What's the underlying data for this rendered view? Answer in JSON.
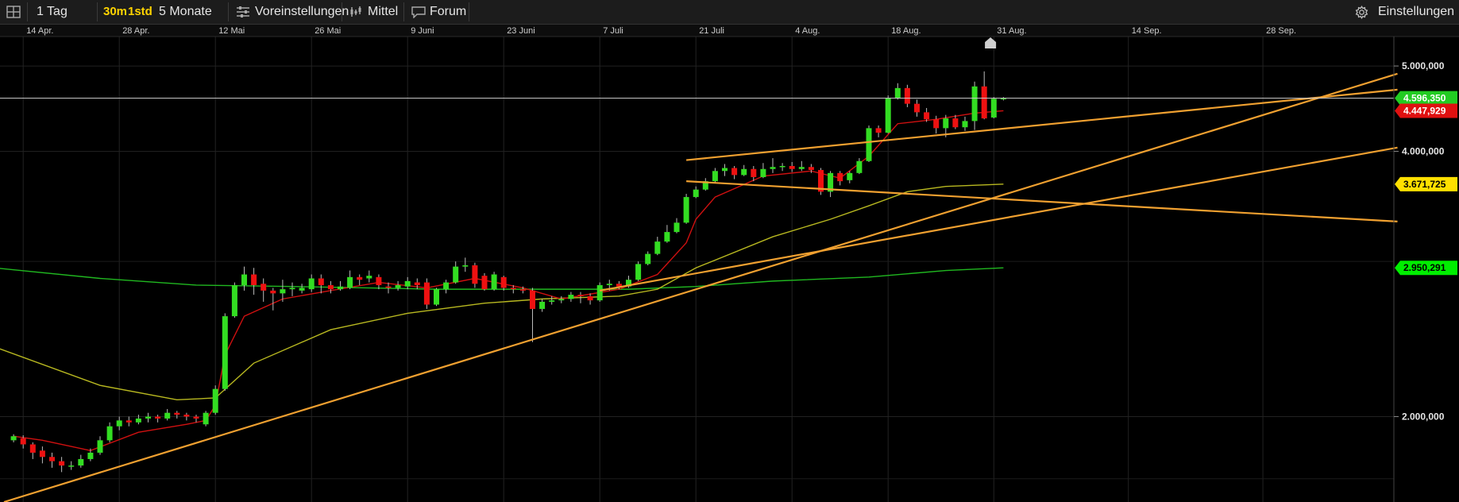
{
  "toolbar": {
    "period": "1 Tag",
    "interval_30m": "30m",
    "interval_1std": "1std",
    "range": "5 Monate",
    "presets": "Voreinstellungen",
    "average": "Mittel",
    "forum": "Forum",
    "settings": "Einstellungen"
  },
  "icons": [
    "layout-icon",
    "sliders-icon",
    "chart-icon",
    "chat-icon",
    "gear-icon"
  ],
  "colors": {
    "up": "#33dd22",
    "down": "#ee1111",
    "trendline": "#f0a030",
    "ma_short": "#d01010",
    "ma_mid": "#b8b820",
    "ma_long": "#20b820",
    "last_price": "#22cc22",
    "badge_red": "#e01010",
    "badge_yellow": "#ffe000",
    "badge_green": "#00ee00"
  },
  "chart_data": {
    "type": "candlestick",
    "scale": "log",
    "grid": true,
    "x_ticks": [
      "14 Apr.",
      "28 Apr.",
      "12 Mai",
      "26 Mai",
      "9 Juni",
      "23 Juni",
      "7 Juli",
      "21 Juli",
      "4 Aug.",
      "18 Aug.",
      "31 Aug.",
      "14 Sep.",
      "28 Sep."
    ],
    "y_ticks": [
      {
        "value": 2000000,
        "label": "2.000,000"
      },
      {
        "value": 4000000,
        "label": "4.000,000"
      },
      {
        "value": 5000000,
        "label": "5.000,000"
      }
    ],
    "y_range": [
      1600000,
      5400000
    ],
    "badges": [
      {
        "value": 4596350,
        "label": "4.596,350",
        "kind": "last_price"
      },
      {
        "value": 4447929,
        "label": "4.447,929",
        "kind": "badge_red"
      },
      {
        "value": 3671725,
        "label": "3.671,725",
        "kind": "badge_yellow"
      },
      {
        "value": 2950291,
        "label": "2.950,291",
        "kind": "badge_green"
      }
    ],
    "candles": [
      [
        1,
        1880000,
        1900000,
        1870000,
        1910000
      ],
      [
        2,
        1890000,
        1860000,
        1840000,
        1905000
      ],
      [
        3,
        1860000,
        1820000,
        1790000,
        1870000
      ],
      [
        4,
        1830000,
        1800000,
        1770000,
        1850000
      ],
      [
        5,
        1800000,
        1780000,
        1750000,
        1820000
      ],
      [
        6,
        1780000,
        1760000,
        1730000,
        1800000
      ],
      [
        7,
        1760000,
        1760000,
        1740000,
        1780000
      ],
      [
        8,
        1760000,
        1790000,
        1750000,
        1810000
      ],
      [
        9,
        1790000,
        1820000,
        1780000,
        1840000
      ],
      [
        10,
        1820000,
        1880000,
        1810000,
        1900000
      ],
      [
        11,
        1880000,
        1950000,
        1870000,
        1970000
      ],
      [
        12,
        1950000,
        1980000,
        1930000,
        2000000
      ],
      [
        13,
        1980000,
        1970000,
        1950000,
        2000000
      ],
      [
        14,
        1970000,
        1990000,
        1960000,
        2010000
      ],
      [
        15,
        1990000,
        2000000,
        1970000,
        2020000
      ],
      [
        16,
        2000000,
        1990000,
        1970000,
        2010000
      ],
      [
        17,
        1990000,
        2020000,
        1980000,
        2040000
      ],
      [
        18,
        2020000,
        2010000,
        1990000,
        2030000
      ],
      [
        19,
        2010000,
        2000000,
        1980000,
        2020000
      ],
      [
        20,
        2000000,
        1990000,
        1970000,
        2010000
      ],
      [
        21,
        1960000,
        2020000,
        1950000,
        2030000
      ],
      [
        22,
        2020000,
        2150000,
        2010000,
        2170000
      ],
      [
        23,
        2150000,
        2600000,
        2140000,
        2620000
      ],
      [
        24,
        2600000,
        2820000,
        2590000,
        2840000
      ],
      [
        25,
        2820000,
        2900000,
        2780000,
        2960000
      ],
      [
        26,
        2900000,
        2820000,
        2750000,
        2950000
      ],
      [
        27,
        2830000,
        2780000,
        2700000,
        2870000
      ],
      [
        28,
        2780000,
        2760000,
        2640000,
        2800000
      ],
      [
        29,
        2760000,
        2790000,
        2700000,
        2860000
      ],
      [
        30,
        2790000,
        2800000,
        2740000,
        2840000
      ],
      [
        31,
        2780000,
        2800000,
        2760000,
        2830000
      ],
      [
        32,
        2790000,
        2870000,
        2770000,
        2900000
      ],
      [
        33,
        2870000,
        2820000,
        2760000,
        2900000
      ],
      [
        34,
        2820000,
        2790000,
        2760000,
        2850000
      ],
      [
        35,
        2790000,
        2810000,
        2780000,
        2850000
      ],
      [
        36,
        2800000,
        2880000,
        2790000,
        2930000
      ],
      [
        37,
        2880000,
        2860000,
        2820000,
        2900000
      ],
      [
        38,
        2870000,
        2890000,
        2840000,
        2930000
      ],
      [
        39,
        2880000,
        2820000,
        2790000,
        2900000
      ],
      [
        40,
        2810000,
        2800000,
        2760000,
        2840000
      ],
      [
        41,
        2800000,
        2820000,
        2780000,
        2850000
      ],
      [
        42,
        2810000,
        2850000,
        2790000,
        2880000
      ],
      [
        43,
        2840000,
        2820000,
        2790000,
        2870000
      ],
      [
        44,
        2840000,
        2680000,
        2650000,
        2870000
      ],
      [
        45,
        2680000,
        2790000,
        2670000,
        2800000
      ],
      [
        46,
        2790000,
        2840000,
        2760000,
        2860000
      ],
      [
        47,
        2840000,
        2960000,
        2830000,
        3000000
      ],
      [
        48,
        2960000,
        2970000,
        2920000,
        3030000
      ],
      [
        49,
        2970000,
        2830000,
        2800000,
        2990000
      ],
      [
        50,
        2890000,
        2790000,
        2780000,
        2910000
      ],
      [
        51,
        2790000,
        2900000,
        2780000,
        2920000
      ],
      [
        52,
        2880000,
        2800000,
        2780000,
        2890000
      ],
      [
        53,
        2800000,
        2790000,
        2760000,
        2820000
      ],
      [
        54,
        2790000,
        2780000,
        2760000,
        2810000
      ],
      [
        55,
        2780000,
        2650000,
        2430000,
        2800000
      ],
      [
        56,
        2650000,
        2700000,
        2630000,
        2720000
      ],
      [
        57,
        2700000,
        2710000,
        2680000,
        2740000
      ],
      [
        58,
        2710000,
        2720000,
        2690000,
        2740000
      ],
      [
        59,
        2720000,
        2750000,
        2700000,
        2770000
      ],
      [
        60,
        2750000,
        2740000,
        2690000,
        2770000
      ],
      [
        61,
        2740000,
        2710000,
        2680000,
        2760000
      ],
      [
        62,
        2710000,
        2820000,
        2700000,
        2840000
      ],
      [
        63,
        2820000,
        2830000,
        2780000,
        2860000
      ],
      [
        64,
        2830000,
        2810000,
        2790000,
        2850000
      ],
      [
        65,
        2810000,
        2860000,
        2800000,
        2890000
      ],
      [
        66,
        2860000,
        2980000,
        2850000,
        3000000
      ],
      [
        67,
        2980000,
        3060000,
        2970000,
        3080000
      ],
      [
        68,
        3060000,
        3160000,
        3050000,
        3200000
      ],
      [
        69,
        3160000,
        3240000,
        3150000,
        3300000
      ],
      [
        70,
        3240000,
        3320000,
        3230000,
        3360000
      ],
      [
        71,
        3320000,
        3550000,
        3310000,
        3580000
      ],
      [
        72,
        3550000,
        3620000,
        3540000,
        3650000
      ],
      [
        73,
        3620000,
        3700000,
        3610000,
        3730000
      ],
      [
        74,
        3700000,
        3800000,
        3690000,
        3830000
      ],
      [
        75,
        3800000,
        3830000,
        3750000,
        3870000
      ],
      [
        76,
        3830000,
        3760000,
        3720000,
        3850000
      ],
      [
        77,
        3760000,
        3820000,
        3750000,
        3860000
      ],
      [
        78,
        3820000,
        3740000,
        3700000,
        3850000
      ],
      [
        79,
        3740000,
        3820000,
        3730000,
        3880000
      ],
      [
        80,
        3820000,
        3840000,
        3780000,
        3930000
      ],
      [
        81,
        3840000,
        3850000,
        3800000,
        3880000
      ],
      [
        82,
        3850000,
        3820000,
        3790000,
        3890000
      ],
      [
        83,
        3820000,
        3840000,
        3800000,
        3900000
      ],
      [
        84,
        3840000,
        3810000,
        3780000,
        3870000
      ],
      [
        85,
        3810000,
        3600000,
        3570000,
        3830000
      ],
      [
        86,
        3600000,
        3780000,
        3550000,
        3800000
      ],
      [
        87,
        3780000,
        3700000,
        3660000,
        3800000
      ],
      [
        88,
        3710000,
        3780000,
        3680000,
        3800000
      ],
      [
        89,
        3780000,
        3900000,
        3770000,
        3930000
      ],
      [
        90,
        3900000,
        4250000,
        3890000,
        4280000
      ],
      [
        91,
        4250000,
        4200000,
        4150000,
        4280000
      ],
      [
        92,
        4200000,
        4600000,
        4190000,
        4630000
      ],
      [
        93,
        4600000,
        4720000,
        4580000,
        4780000
      ],
      [
        94,
        4720000,
        4530000,
        4490000,
        4760000
      ],
      [
        95,
        4530000,
        4430000,
        4380000,
        4580000
      ],
      [
        96,
        4430000,
        4350000,
        4320000,
        4480000
      ],
      [
        97,
        4350000,
        4250000,
        4190000,
        4390000
      ],
      [
        98,
        4250000,
        4360000,
        4150000,
        4400000
      ],
      [
        99,
        4360000,
        4260000,
        4240000,
        4400000
      ],
      [
        100,
        4260000,
        4330000,
        4220000,
        4380000
      ],
      [
        101,
        4330000,
        4740000,
        4230000,
        4800000
      ],
      [
        102,
        4740000,
        4360000,
        4350000,
        4930000
      ],
      [
        103,
        4370000,
        4590000,
        4360000,
        4610000
      ],
      [
        104,
        4590000,
        4596350,
        4570000,
        4610000
      ]
    ],
    "x_ticks_at": [
      2,
      12,
      22,
      32,
      42,
      52,
      62,
      72,
      82,
      92,
      103,
      117,
      131
    ],
    "ma_short": [
      [
        1,
        1900000
      ],
      [
        4,
        1880000
      ],
      [
        7,
        1850000
      ],
      [
        9,
        1830000
      ],
      [
        14,
        1920000
      ],
      [
        19,
        1960000
      ],
      [
        21,
        1980000
      ],
      [
        22,
        2060000
      ],
      [
        23,
        2350000
      ],
      [
        25,
        2600000
      ],
      [
        29,
        2720000
      ],
      [
        34,
        2780000
      ],
      [
        39,
        2840000
      ],
      [
        44,
        2800000
      ],
      [
        49,
        2870000
      ],
      [
        54,
        2800000
      ],
      [
        58,
        2720000
      ],
      [
        64,
        2790000
      ],
      [
        68,
        2900000
      ],
      [
        71,
        3150000
      ],
      [
        72,
        3350000
      ],
      [
        74,
        3550000
      ],
      [
        79,
        3750000
      ],
      [
        84,
        3800000
      ],
      [
        87,
        3730000
      ],
      [
        90,
        3950000
      ],
      [
        93,
        4300000
      ],
      [
        97,
        4350000
      ],
      [
        101,
        4420000
      ],
      [
        104,
        4447929
      ]
    ],
    "ma_mid": [
      [
        -1,
        2400000
      ],
      [
        10,
        2170000
      ],
      [
        18,
        2090000
      ],
      [
        22,
        2100000
      ],
      [
        26,
        2300000
      ],
      [
        34,
        2510000
      ],
      [
        42,
        2620000
      ],
      [
        50,
        2690000
      ],
      [
        56,
        2720000
      ],
      [
        64,
        2740000
      ],
      [
        68,
        2790000
      ],
      [
        72,
        2950000
      ],
      [
        80,
        3200000
      ],
      [
        86,
        3350000
      ],
      [
        90,
        3470000
      ],
      [
        94,
        3600000
      ],
      [
        98,
        3650000
      ],
      [
        104,
        3671725
      ]
    ],
    "ma_long": [
      [
        -1,
        2950000
      ],
      [
        10,
        2870000
      ],
      [
        20,
        2820000
      ],
      [
        30,
        2810000
      ],
      [
        45,
        2790000
      ],
      [
        55,
        2790000
      ],
      [
        65,
        2790000
      ],
      [
        72,
        2810000
      ],
      [
        80,
        2850000
      ],
      [
        90,
        2880000
      ],
      [
        98,
        2930000
      ],
      [
        104,
        2950291
      ]
    ],
    "trendlines": [
      [
        [
          0,
          1600000
        ],
        [
          145,
          4900000
        ]
      ],
      [
        [
          71,
          3910000
        ],
        [
          145,
          4700000
        ]
      ],
      [
        [
          71,
          3700000
        ],
        [
          145,
          3330000
        ]
      ],
      [
        [
          62,
          2780000
        ],
        [
          145,
          4040000
        ]
      ]
    ],
    "marker_at": 101
  }
}
